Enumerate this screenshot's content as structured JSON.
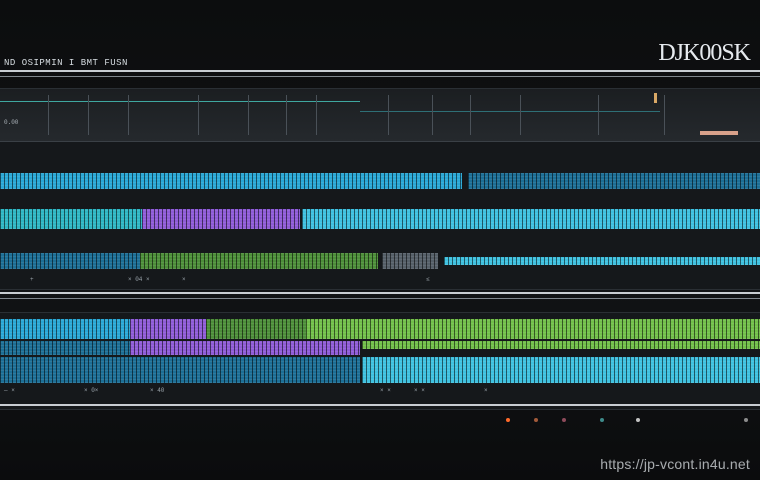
{
  "header": {
    "title": "ND OSIPMIN I BMT FUSN",
    "logo": "DJK00SK"
  },
  "timeline_top": {
    "ruler_label": "0.00",
    "footer_items": [
      "+",
      "× 04 ×",
      "×",
      "≤"
    ]
  },
  "timeline_bottom": {
    "footer_items": [
      "— ×",
      "× 0×",
      "× 40",
      "× ×",
      "× ×",
      "×"
    ]
  },
  "bottom_bar": {
    "indicators": [
      "#ff6a2a",
      "#a25a3a",
      "#8d4a5a",
      "#3e8a8a",
      "#c2c2c2",
      "#8c8c8c"
    ]
  },
  "watermark": "https://jp-vcont.in4u.net",
  "colors": {
    "accent_blue": "#2aa8d6",
    "accent_purple": "#8f5cd8",
    "accent_green": "#72c04a",
    "background": "#0b0c0d"
  }
}
